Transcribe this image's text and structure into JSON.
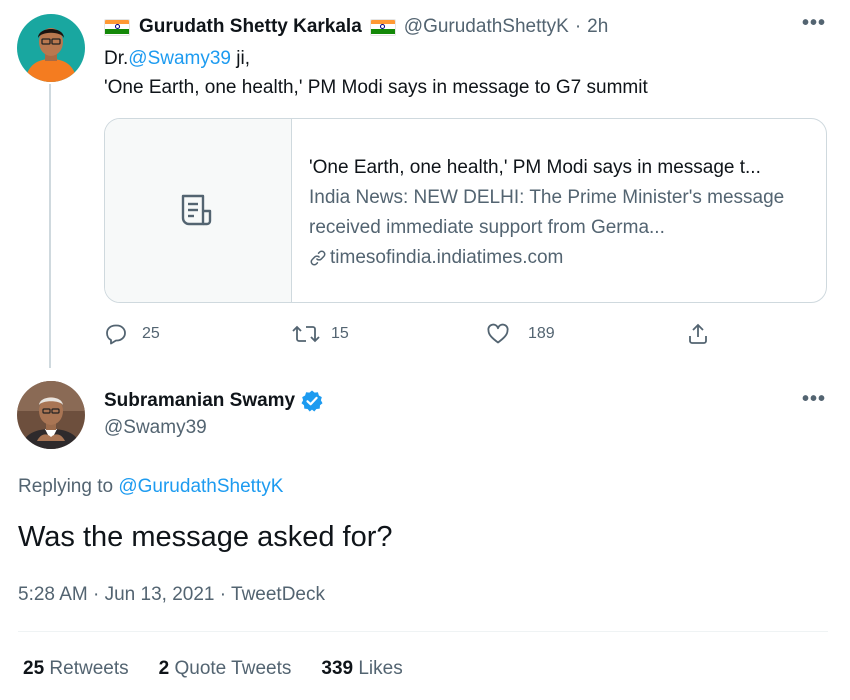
{
  "parent_tweet": {
    "display_name": "Gurudath Shetty Karkala",
    "handle": "@GurudathShettyK",
    "separator": "·",
    "time": "2h",
    "text_prefix": "Dr.",
    "text_mention": "@Swamy39",
    "text_suffix": " ji,",
    "text_line2": "'One Earth, one health,' PM Modi says in message to G7 summit",
    "card": {
      "title": "'One Earth, one health,' PM Modi says in message t...",
      "description": "India News: NEW DELHI: The Prime Minister's message received immediate support from Germa...",
      "domain": "timesofindia.indiatimes.com"
    },
    "actions": {
      "replies": "25",
      "retweets": "15",
      "likes": "189"
    }
  },
  "main_tweet": {
    "display_name": "Subramanian Swamy",
    "handle": "@Swamy39",
    "replying_prefix": "Replying to ",
    "replying_to": "@GurudathShettyK",
    "text": "Was the message asked for?",
    "timestamp": "5:28 AM · Jun 13, 2021 · TweetDeck",
    "stats": {
      "retweets_count": "25",
      "retweets_label": "Retweets",
      "quotes_count": "2",
      "quotes_label": "Quote Tweets",
      "likes_count": "339",
      "likes_label": "Likes"
    }
  },
  "colors": {
    "accent": "#1d9bf0",
    "muted": "#536471",
    "border": "#cfd9de",
    "saffron": "#ff9933",
    "india_green": "#138808"
  },
  "icons": [
    "more-icon",
    "article-icon",
    "link-icon",
    "reply-icon",
    "retweet-icon",
    "like-icon",
    "share-icon",
    "verified-badge-icon",
    "flag-india-icon"
  ]
}
